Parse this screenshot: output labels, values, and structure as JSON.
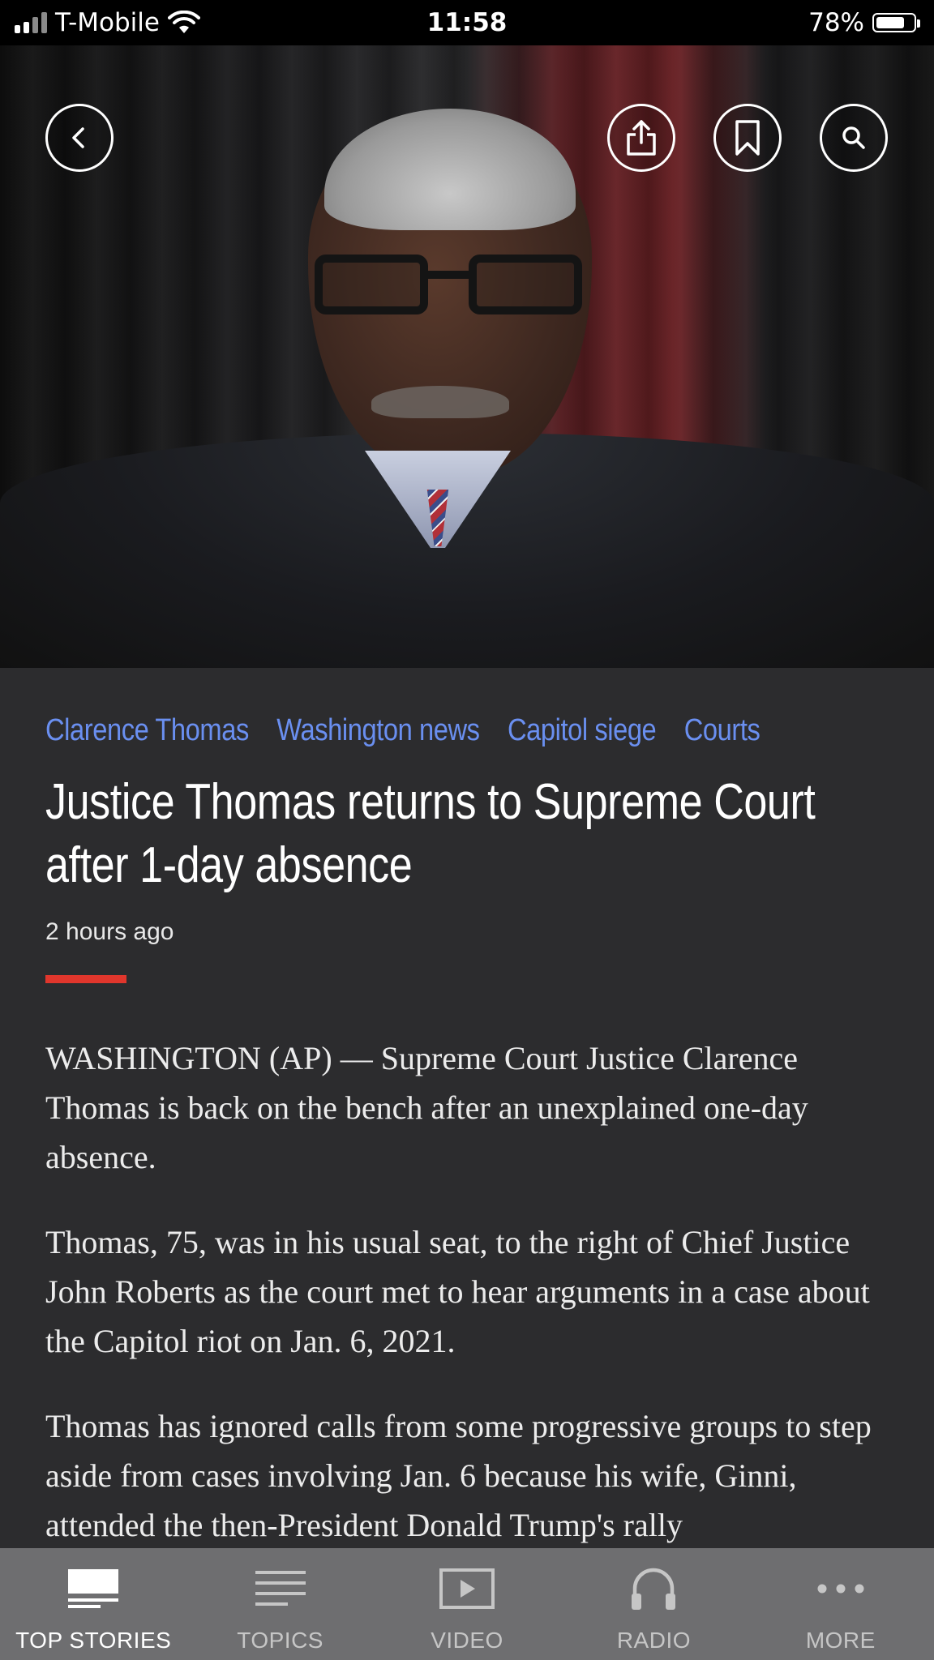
{
  "status_bar": {
    "carrier": "T-Mobile",
    "time": "11:58",
    "battery_percent": "78%",
    "battery_level": 0.78,
    "signal_bars": 2
  },
  "hero_buttons": {
    "back_icon": "chevron-left-icon",
    "share_icon": "share-icon",
    "bookmark_icon": "bookmark-icon",
    "search_icon": "search-icon"
  },
  "article": {
    "tags": [
      "Clarence Thomas",
      "Washington news",
      "Capitol siege",
      "Courts"
    ],
    "headline": "Justice Thomas returns to Supreme Court after 1-day absence",
    "timestamp": "2 hours ago",
    "paragraphs": [
      "WASHINGTON (AP) — Supreme Court Justice Clarence Thomas is back on the bench after an unexplained one-day absence.",
      "Thomas, 75, was in his usual seat, to the right of Chief Justice John Roberts as the court met to hear arguments in a case about the Capitol riot on Jan. 6, 2021.",
      "Thomas has ignored calls from some progressive groups to step aside from cases involving Jan. 6 because his wife, Ginni, attended the then-President Donald Trump's rally"
    ]
  },
  "tabbar": {
    "items": [
      {
        "label": "TOP STORIES",
        "icon": "newspaper-icon",
        "active": true
      },
      {
        "label": "TOPICS",
        "icon": "list-icon",
        "active": false
      },
      {
        "label": "VIDEO",
        "icon": "play-icon",
        "active": false
      },
      {
        "label": "RADIO",
        "icon": "headphones-icon",
        "active": false
      },
      {
        "label": "MORE",
        "icon": "more-dots-icon",
        "active": false
      }
    ]
  },
  "colors": {
    "tag_link": "#6a8ff0",
    "accent_bar": "#e0362c",
    "background": "#2c2c2e",
    "tabbar": "#6e6e70"
  }
}
